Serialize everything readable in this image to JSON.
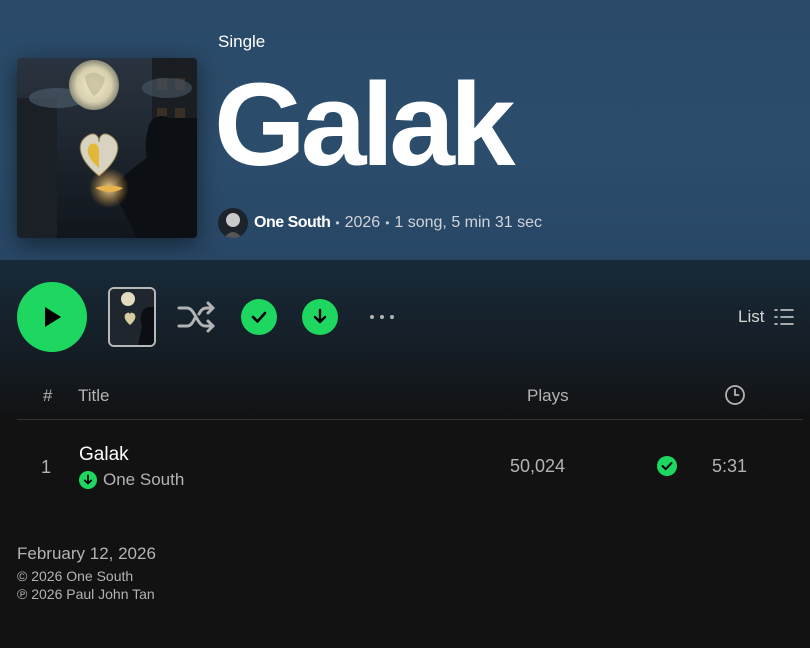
{
  "album": {
    "type": "Single",
    "title": "Galak",
    "artist": "One South",
    "year": "2026",
    "summary": "1 song, 5 min 31 sec"
  },
  "controls": {
    "list_label": "List",
    "icons": [
      "play-icon",
      "shuffle-icon",
      "check-icon",
      "download-arrow-icon",
      "more-icon",
      "list-view-icon"
    ]
  },
  "table": {
    "headers": {
      "number": "#",
      "title": "Title",
      "plays": "Plays",
      "duration_icon": "clock-icon"
    },
    "rows": [
      {
        "number": "1",
        "title": "Galak",
        "artist": "One South",
        "plays": "50,024",
        "duration": "5:31",
        "downloaded": true,
        "saved": true
      }
    ]
  },
  "footer": {
    "release_date": "February 12, 2026",
    "copyright": "© 2026 One South",
    "phonographic": "℗ 2026 Paul John Tan"
  },
  "colors": {
    "accent": "#1ed760",
    "header_bg": "#2b4c6b",
    "background": "#121212",
    "muted_text": "#b3b3b3"
  }
}
